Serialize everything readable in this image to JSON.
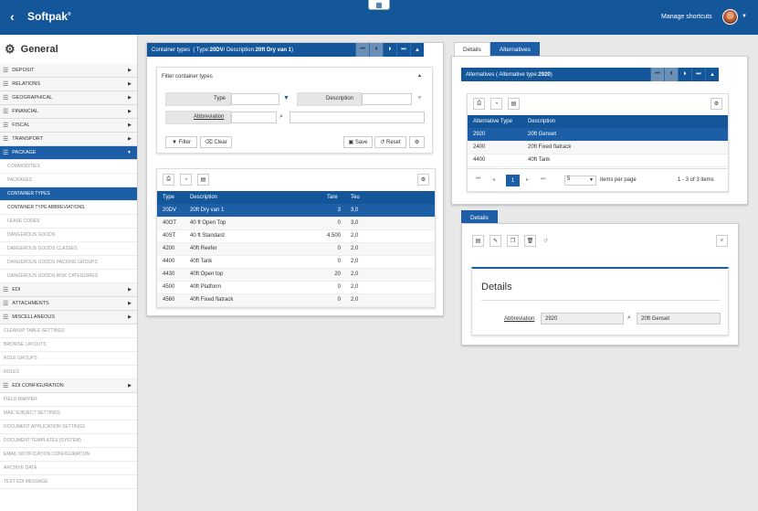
{
  "app": {
    "brand": "Softpak",
    "trademark": "®",
    "back": "‹",
    "grid_icon": "▦",
    "shortcuts": "Manage shortcuts",
    "caret": "▼"
  },
  "sidebar": {
    "title": "General",
    "items": [
      {
        "label": "DEPOSIT",
        "type": "group"
      },
      {
        "label": "RELATIONS",
        "type": "group"
      },
      {
        "label": "GEOGRAPHICAL",
        "type": "group"
      },
      {
        "label": "FINANCIAL",
        "type": "group"
      },
      {
        "label": "FISCAL",
        "type": "group"
      },
      {
        "label": "TRANSPORT",
        "type": "group"
      },
      {
        "label": "PACKAGE",
        "type": "group-open"
      },
      {
        "label": "COMMODITIES",
        "type": "sub"
      },
      {
        "label": "PACKAGES",
        "type": "sub"
      },
      {
        "label": "CONTAINER TYPES",
        "type": "sub-sel"
      },
      {
        "label": "CONTAINER TYPE ABBREVIATIONS",
        "type": "sub-dark"
      },
      {
        "label": "LEASE CODES",
        "type": "sub"
      },
      {
        "label": "DANGEROUS GOODS",
        "type": "sub"
      },
      {
        "label": "DANGEROUS GOODS CLASSES",
        "type": "sub"
      },
      {
        "label": "DANGEROUS GOODS PACKING GROUPS",
        "type": "sub"
      },
      {
        "label": "DANGEROUS GOODS RISK CATEGORIES",
        "type": "sub"
      },
      {
        "label": "EDI",
        "type": "group"
      },
      {
        "label": "ATTACHMENTS",
        "type": "group"
      },
      {
        "label": "MISCELLANEOUS",
        "type": "group"
      },
      {
        "label": "CLEANUP TABLE SETTINGS",
        "type": "plain"
      },
      {
        "label": "BROWSE LAYOUTS",
        "type": "plain"
      },
      {
        "label": "ROLE GROUPS",
        "type": "plain"
      },
      {
        "label": "ROLES",
        "type": "plain"
      },
      {
        "label": "EDI CONFIGURATION",
        "type": "group"
      },
      {
        "label": "FIELD MAPPER",
        "type": "plain"
      },
      {
        "label": "MAIL SUBJECT SETTINGS",
        "type": "plain"
      },
      {
        "label": "DOCUMENT APPLICATION SETTINGS",
        "type": "plain"
      },
      {
        "label": "DOCUMENT TEMPLATES (SYSTEM)",
        "type": "plain"
      },
      {
        "label": "EMAIL NOTIFICATION CONFIGURATION",
        "type": "plain"
      },
      {
        "label": "ARCHIVE DATA",
        "type": "plain"
      },
      {
        "label": "TEST EDI MESSAGE",
        "type": "plain"
      }
    ]
  },
  "container_types": {
    "header_prefix": "Container types",
    "header_detail_prefix": "( Type: ",
    "header_type": "20DV",
    "header_mid": " / Description: ",
    "header_desc": "20ft Dry van 1",
    "header_suffix": " )",
    "filter": {
      "title": "Filter container types",
      "type_label": "Type",
      "description_label": "Description",
      "abbreviation_label": "Abbreviation",
      "filter_btn": "Filter",
      "clear_btn": "Clear",
      "save_btn": "Save",
      "reset_btn": "Reset"
    },
    "columns": [
      "Type",
      "Description",
      "Tare",
      "Teu"
    ],
    "rows": [
      {
        "type": "20DV",
        "desc": "20ft Dry van 1",
        "tare": "3",
        "teu": "3,0"
      },
      {
        "type": "40OT",
        "desc": "40 ft Open Top",
        "tare": "0",
        "teu": "3,0"
      },
      {
        "type": "40ST",
        "desc": "40 ft Standard",
        "tare": "4.500",
        "teu": "2,0"
      },
      {
        "type": "4200",
        "desc": "40ft Reefer",
        "tare": "0",
        "teu": "2,0"
      },
      {
        "type": "4400",
        "desc": "40ft Tank",
        "tare": "0",
        "teu": "2,0"
      },
      {
        "type": "4430",
        "desc": "40ft Open top",
        "tare": "20",
        "teu": "2,0"
      },
      {
        "type": "4500",
        "desc": "40ft Platform",
        "tare": "0",
        "teu": "2,0"
      },
      {
        "type": "4560",
        "desc": "40ft Fixed flatrack",
        "tare": "0",
        "teu": "2,0"
      }
    ]
  },
  "right": {
    "tabs": [
      "Details",
      "Alternatives"
    ],
    "alt_header_prefix": "Alternatives",
    "alt_header_detail": "( Alternative type: ",
    "alt_header_value": "2920",
    "alt_header_suffix": " )",
    "alt_columns": [
      "Alternative Type",
      "Description"
    ],
    "alt_rows": [
      {
        "type": "2920",
        "desc": "20ft Genset"
      },
      {
        "type": "2400",
        "desc": "20ft Fixed flatrack"
      },
      {
        "type": "4400",
        "desc": "40ft Tank"
      }
    ],
    "pager": {
      "page": "1",
      "page_size": "5",
      "items_per_page": "items per page",
      "range": "1 - 3 of 3 items"
    },
    "details_tab": "Details",
    "details_title": "Details",
    "abbreviation_label": "Abbreviation",
    "abbreviation_value": "2920",
    "abbreviation_desc": "20ft Genset"
  }
}
